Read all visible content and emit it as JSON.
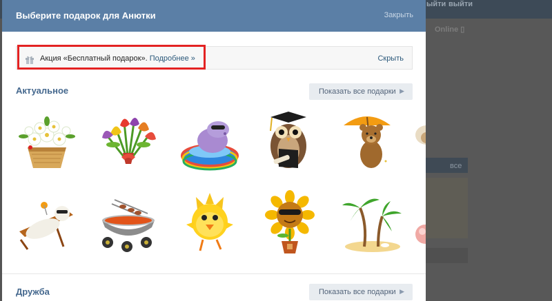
{
  "background": {
    "top_links": [
      "ыйти",
      "выйти"
    ],
    "online_label": "Online",
    "all_label": "все"
  },
  "dialog": {
    "title": "Выберите подарок для Анютки",
    "close_label": "Закрыть"
  },
  "promo": {
    "text": "Акция «Бесплатный подарок». ",
    "link": "Подробнее »",
    "hide": "Скрыть"
  },
  "sections": [
    {
      "title": "Актуальное",
      "show_all": "Показать все подарки"
    },
    {
      "title": "Дружба",
      "show_all": "Показать все подарки"
    }
  ],
  "gifts": [
    {
      "icon": "flower-basket-icon"
    },
    {
      "icon": "tulip-bouquet-icon"
    },
    {
      "icon": "hippo-pool-icon"
    },
    {
      "icon": "graduate-owl-icon"
    },
    {
      "icon": "bear-umbrella-icon"
    },
    {
      "icon": "sheep-icon"
    },
    {
      "icon": "sunbathing-bear-icon"
    },
    {
      "icon": "grill-icon"
    },
    {
      "icon": "sun-chick-icon"
    },
    {
      "icon": "sunflower-sunglasses-icon"
    },
    {
      "icon": "palm-island-icon"
    },
    {
      "icon": "pink-ball-icon"
    }
  ],
  "colors": {
    "header": "#5b7fa6",
    "link": "#2b587a",
    "section_title": "#45688e",
    "highlight": "#e32222"
  }
}
